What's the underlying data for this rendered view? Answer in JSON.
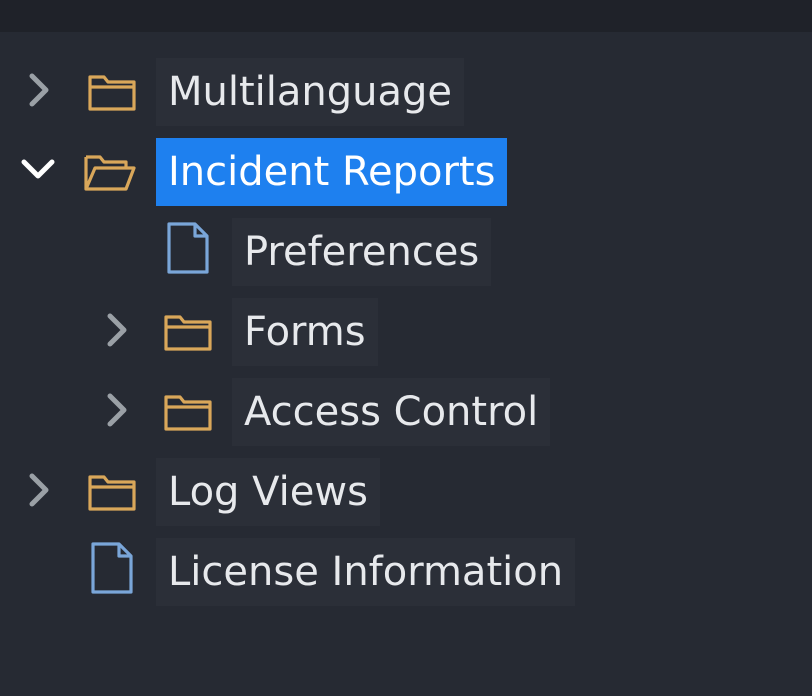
{
  "tree": {
    "items": [
      {
        "label": "Multilanguage",
        "type": "folder",
        "state": "collapsed"
      },
      {
        "label": "Incident Reports",
        "type": "folder",
        "state": "expanded",
        "selected": true
      },
      {
        "label": "Preferences",
        "type": "file"
      },
      {
        "label": "Forms",
        "type": "folder",
        "state": "collapsed"
      },
      {
        "label": "Access Control",
        "type": "folder",
        "state": "collapsed"
      },
      {
        "label": "Log Views",
        "type": "folder",
        "state": "collapsed"
      },
      {
        "label": "License Information",
        "type": "file"
      }
    ]
  },
  "colors": {
    "background": "#262a33",
    "topbar": "#1f2229",
    "label_bg": "#2b2f38",
    "selected_bg": "#1e80ef",
    "text": "#e7e9ec",
    "folder_icon": "#d9a75a",
    "file_icon": "#7aa6d9",
    "chevron": "#9aa0a6",
    "chevron_expanded": "#ffffff"
  }
}
